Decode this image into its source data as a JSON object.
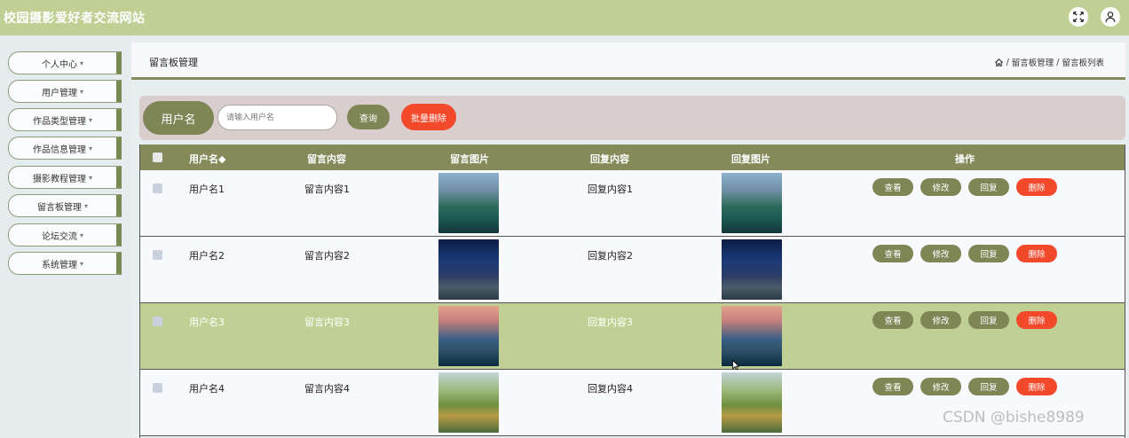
{
  "header": {
    "site_title": "校园摄影爱好者交流网站",
    "icons": [
      "fullscreen-icon",
      "user-icon"
    ]
  },
  "sidebar": {
    "items": [
      {
        "label": "个人中心"
      },
      {
        "label": "用户管理"
      },
      {
        "label": "作品类型管理"
      },
      {
        "label": "作品信息管理"
      },
      {
        "label": "摄影教程管理"
      },
      {
        "label": "留言板管理"
      },
      {
        "label": "论坛交流"
      },
      {
        "label": "系统管理"
      }
    ],
    "caret": "▾"
  },
  "page": {
    "title": "留言板管理",
    "breadcrumb": [
      {
        "label": "留言板管理"
      },
      {
        "label": "留言板列表"
      }
    ],
    "breadcrumb_sep": "/"
  },
  "search": {
    "label": "用户名",
    "placeholder": "请输入用户名",
    "query_button": "查询",
    "batch_delete_button": "批量删除"
  },
  "table": {
    "columns": [
      "用户名◆",
      "留言内容",
      "留言图片",
      "回复内容",
      "回复图片",
      "操作"
    ],
    "rows": [
      {
        "username": "用户名1",
        "message": "留言内容1",
        "reply": "回复内容1",
        "highlighted": false
      },
      {
        "username": "用户名2",
        "message": "留言内容2",
        "reply": "回复内容2",
        "highlighted": false
      },
      {
        "username": "用户名3",
        "message": "留言内容3",
        "reply": "回复内容3",
        "highlighted": true
      },
      {
        "username": "用户名4",
        "message": "留言内容4",
        "reply": "回复内容4",
        "highlighted": false
      }
    ],
    "actions": {
      "view": "查看",
      "edit": "修改",
      "reply": "回复",
      "delete": "删除"
    }
  },
  "watermark": "CSDN @bishe8989",
  "colors": {
    "header_bg": "#c0d094",
    "olive": "#7f8656",
    "table_header": "#848a5a",
    "danger": "#f2492b",
    "search_bar_bg": "#d9cdcd",
    "highlight_row": "#c0d094"
  }
}
